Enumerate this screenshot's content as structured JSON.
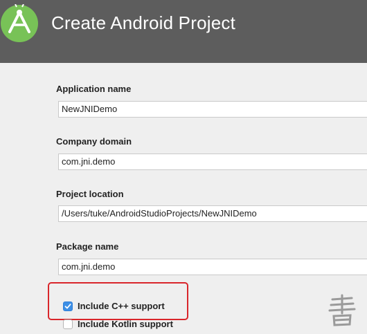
{
  "window": {
    "title": "Create Android Project"
  },
  "logo": {
    "icon": "android-studio-icon"
  },
  "fields": {
    "application_name": {
      "label": "Application name",
      "value": "NewJNIDemo"
    },
    "company_domain": {
      "label": "Company domain",
      "value": "com.jni.demo"
    },
    "project_location": {
      "label": "Project location",
      "value": "/Users/tuke/AndroidStudioProjects/NewJNIDemo"
    },
    "package_name": {
      "label": "Package name",
      "value": "com.jni.demo"
    }
  },
  "options": {
    "cpp_support": {
      "label": "Include C++ support",
      "checked": true
    },
    "kotlin_support": {
      "label": "Include Kotlin support",
      "checked": false
    }
  },
  "colors": {
    "header_bg": "#5d5d5d",
    "accent": "#3d8fe6",
    "highlight_border": "#d9252a"
  }
}
